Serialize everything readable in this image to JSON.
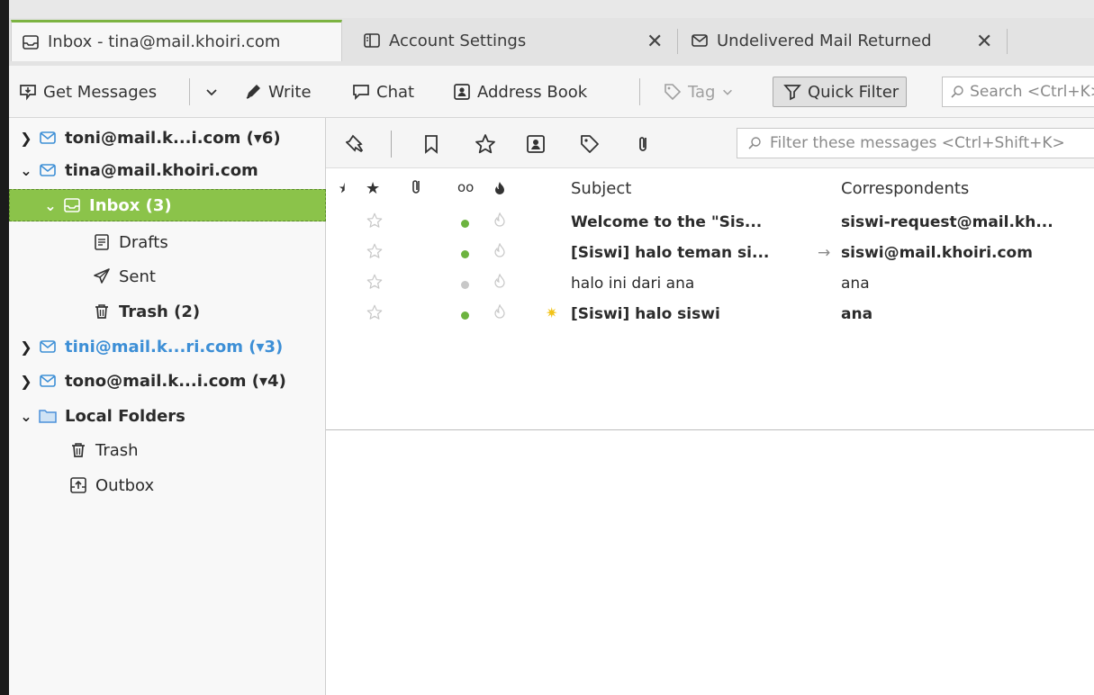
{
  "tabs": [
    {
      "label": "Inbox - tina@mail.khoiri.com",
      "icon": "inbox-icon",
      "active": true
    },
    {
      "label": "Account Settings",
      "icon": "settings-page-icon",
      "active": false
    },
    {
      "label": "Undelivered Mail Returned",
      "icon": "envelope-icon",
      "active": false
    }
  ],
  "toolbar": {
    "get_messages": "Get Messages",
    "write": "Write",
    "chat": "Chat",
    "address_book": "Address Book",
    "tag": "Tag",
    "quick_filter": "Quick Filter",
    "search_placeholder": "Search <Ctrl+K>"
  },
  "folders": [
    {
      "label": "toni@mail.k...i.com (▾6)",
      "type": "account",
      "expanded": false
    },
    {
      "label": "tina@mail.khoiri.com",
      "type": "account",
      "expanded": true
    },
    {
      "label": "Inbox (3)",
      "type": "inbox",
      "selected": true
    },
    {
      "label": "Drafts",
      "type": "drafts"
    },
    {
      "label": "Sent",
      "type": "sent"
    },
    {
      "label": "Trash (2)",
      "type": "trash"
    },
    {
      "label": "tini@mail.k...ri.com (▾3)",
      "type": "account",
      "expanded": false
    },
    {
      "label": "tono@mail.k...i.com (▾4)",
      "type": "account",
      "expanded": false
    },
    {
      "label": "Local Folders",
      "type": "local",
      "expanded": true
    },
    {
      "label": "Trash",
      "type": "trash"
    },
    {
      "label": "Outbox",
      "type": "outbox"
    }
  ],
  "quick_filter_bar": {
    "filter_placeholder": "Filter these messages <Ctrl+Shift+K>"
  },
  "columns": {
    "subject": "Subject",
    "correspondents": "Correspondents"
  },
  "messages": [
    {
      "subject": "Welcome to the \"Sis...",
      "correspondent": "siswi-request@mail.kh...",
      "unread": true,
      "status_color": "#6cb33f",
      "arrow": "",
      "new": false
    },
    {
      "subject": "[Siswi] halo teman si...",
      "correspondent": "siswi@mail.khoiri.com",
      "unread": true,
      "status_color": "#6cb33f",
      "arrow": "→",
      "new": false
    },
    {
      "subject": "halo ini dari ana",
      "correspondent": "ana",
      "unread": false,
      "status_color": "#c8c8c8",
      "arrow": "",
      "new": false
    },
    {
      "subject": "[Siswi] halo siswi",
      "correspondent": "ana",
      "unread": true,
      "status_color": "#6cb33f",
      "arrow": "",
      "new": true
    }
  ]
}
